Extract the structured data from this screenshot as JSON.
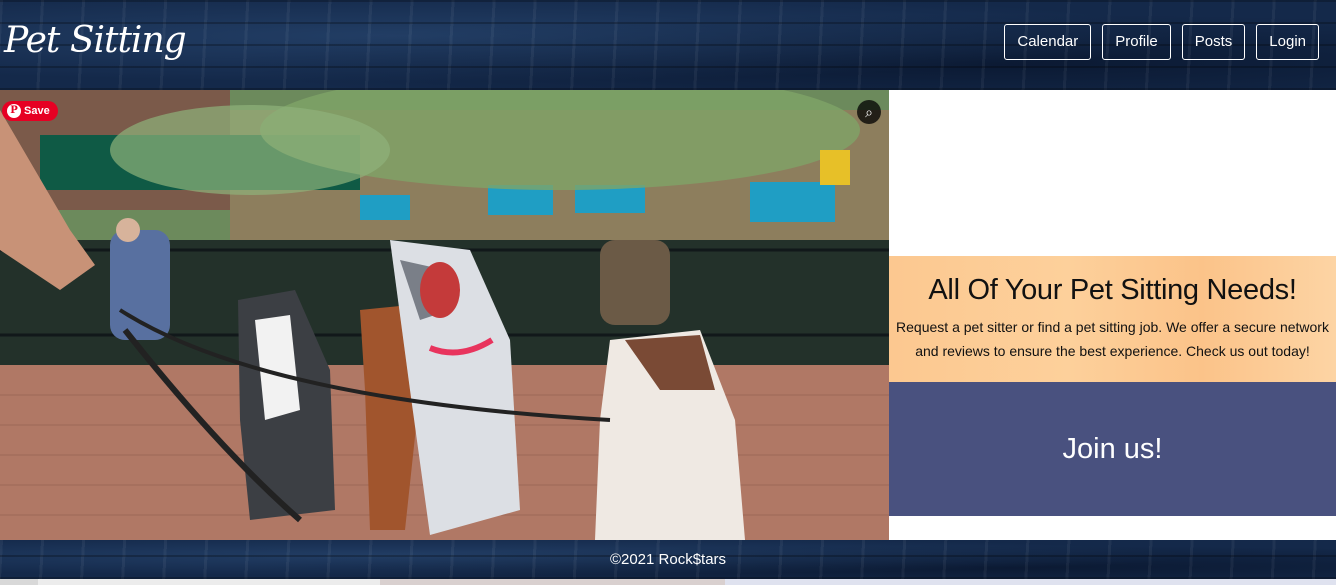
{
  "header": {
    "logo": "Pet Sitting",
    "nav": [
      "Calendar",
      "Profile",
      "Posts",
      "Login"
    ]
  },
  "hero": {
    "save_label": "Save",
    "pin_glyph": "P",
    "lens_icon": "visual-search-icon"
  },
  "promo": {
    "title": "All Of Your Pet Sitting Needs!",
    "body": "Request a pet sitter or find a pet sitting job. We offer a secure network and reviews to ensure the best experience. Check us out today!"
  },
  "join": {
    "label": "Join us!"
  },
  "footer": {
    "copyright": "©2021 Rock$tars"
  },
  "colors": {
    "header_bg": "#14294a",
    "promo_bg": "#fcc890",
    "join_bg": "#49517f",
    "save_red": "#e60023"
  }
}
